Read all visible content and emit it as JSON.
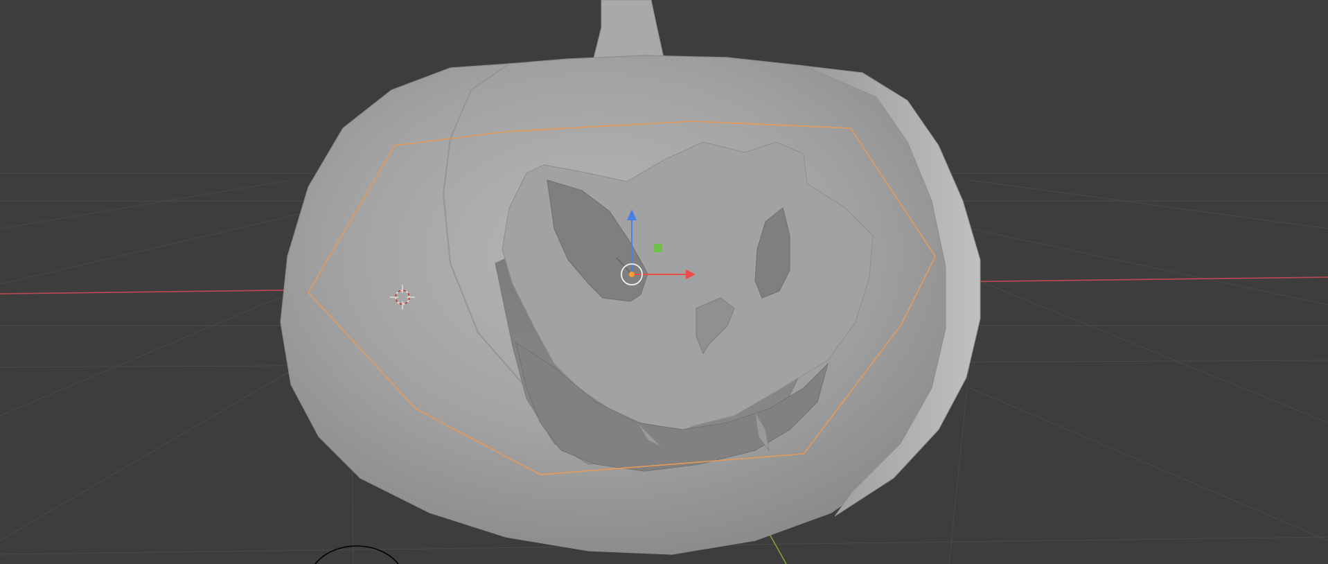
{
  "viewport": {
    "background_color": "#3d3d3d",
    "grid_color": "#4a4a4a",
    "x_axis_color": "#c14852",
    "y_axis_color": "#7fa43a",
    "object_color": "#a7a7a7",
    "selection_outline_color": "#e69a5a",
    "gizmo": {
      "x_arrow_color": "#ef4b4b",
      "y_handle_color": "#6fbf4a",
      "z_arrow_color": "#4a7fe6",
      "pivot_color": "#ff9a2e"
    },
    "icons": {
      "cursor": "3d-cursor-icon",
      "gizmo": "transform-gizmo-icon",
      "light": "light-object-icon"
    }
  }
}
